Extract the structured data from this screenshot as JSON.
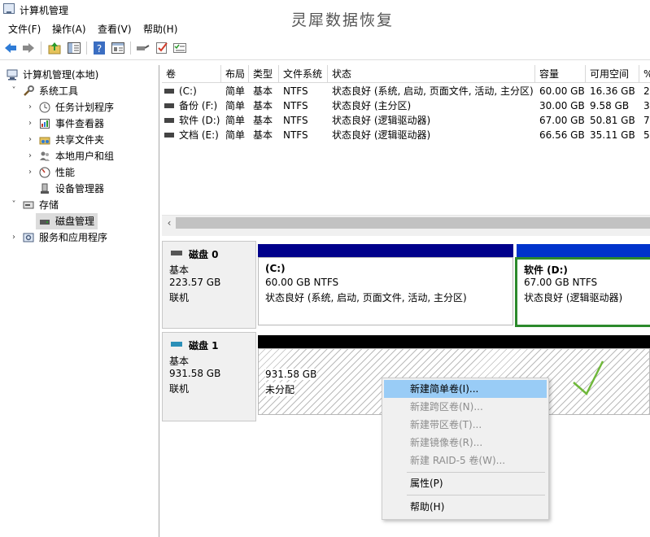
{
  "window": {
    "title": "计算机管理",
    "watermark": "灵犀数据恢复"
  },
  "menu": [
    "文件(F)",
    "操作(A)",
    "查看(V)",
    "帮助(H)"
  ],
  "toolbar": [
    "back-icon",
    "forward-icon",
    "up-folder-icon",
    "show-hide-tree-icon",
    "help-icon",
    "properties-icon",
    "connect-icon",
    "check-icon",
    "list-icon"
  ],
  "tree": {
    "root": "计算机管理(本地)",
    "system_tools": "系统工具",
    "task_scheduler": "任务计划程序",
    "event_viewer": "事件查看器",
    "shared_folders": "共享文件夹",
    "local_users": "本地用户和组",
    "performance": "性能",
    "device_manager": "设备管理器",
    "storage": "存储",
    "disk_management": "磁盘管理",
    "services": "服务和应用程序"
  },
  "volume_table": {
    "columns": [
      "卷",
      "布局",
      "类型",
      "文件系统",
      "状态",
      "容量",
      "可用空间",
      "%"
    ],
    "rows": [
      [
        "(C:)",
        "简单",
        "基本",
        "NTFS",
        "状态良好 (系统, 启动, 页面文件, 活动, 主分区)",
        "60.00 GB",
        "16.36 GB",
        "2"
      ],
      [
        "备份 (F:)",
        "简单",
        "基本",
        "NTFS",
        "状态良好 (主分区)",
        "30.00 GB",
        "9.58 GB",
        "3"
      ],
      [
        "软件 (D:)",
        "简单",
        "基本",
        "NTFS",
        "状态良好 (逻辑驱动器)",
        "67.00 GB",
        "50.81 GB",
        "7"
      ],
      [
        "文档 (E:)",
        "简单",
        "基本",
        "NTFS",
        "状态良好 (逻辑驱动器)",
        "66.56 GB",
        "35.11 GB",
        "5"
      ]
    ]
  },
  "disks": [
    {
      "name": "磁盘 0",
      "type": "基本",
      "size": "223.57 GB",
      "status": "联机",
      "partitions": [
        {
          "title": "(C:)",
          "size": "60.00 GB NTFS",
          "status": "状态良好 (系统, 启动, 页面文件, 活动, 主分区)"
        },
        {
          "title": "软件 (D:)",
          "size": "67.00 GB NTFS",
          "status": "状态良好 (逻辑驱动器)"
        }
      ]
    },
    {
      "name": "磁盘 1",
      "type": "基本",
      "size": "931.58 GB",
      "status": "联机",
      "partitions": [
        {
          "size": "931.58 GB",
          "status": "未分配"
        }
      ]
    }
  ],
  "context_menu": {
    "new_simple": "新建简单卷(I)...",
    "new_spanned": "新建跨区卷(N)...",
    "new_striped": "新建带区卷(T)...",
    "new_mirrored": "新建镜像卷(R)...",
    "new_raid5": "新建 RAID-5 卷(W)...",
    "properties": "属性(P)",
    "help": "帮助(H)"
  },
  "colors": {
    "primary_bar": "#00008b",
    "logical_bar": "#0033cc",
    "unallocated_bar": "#000000",
    "selection_border": "#2c8a2c",
    "highlight": "#99ccf6"
  }
}
